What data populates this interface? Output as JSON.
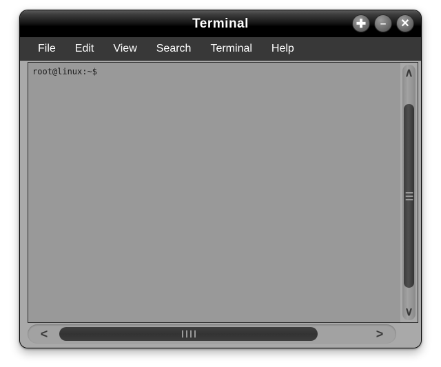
{
  "window": {
    "title": "Terminal",
    "controls": [
      {
        "name": "maximize-button",
        "glyph": "✚",
        "label": "Maximize"
      },
      {
        "name": "minimize-button",
        "glyph": "–",
        "label": "Minimize"
      },
      {
        "name": "close-button",
        "glyph": "✕",
        "label": "Close"
      }
    ]
  },
  "menubar": {
    "items": [
      {
        "label": "File"
      },
      {
        "label": "Edit"
      },
      {
        "label": "View"
      },
      {
        "label": "Search"
      },
      {
        "label": "Terminal"
      },
      {
        "label": "Help"
      }
    ]
  },
  "terminal": {
    "lines": [
      "root@linux:~$"
    ],
    "prompt": "root@linux:~$",
    "background_color": "#999999",
    "text_color": "#1c1c1c"
  },
  "scrollbars": {
    "vertical": {
      "up_arrow": "∧",
      "down_arrow": "∨"
    },
    "horizontal": {
      "left_arrow": "<",
      "right_arrow": ">"
    }
  },
  "theme": {
    "titlebar_color": "#000000",
    "menubar_color": "#383838",
    "frame_color": "#a9a9a9",
    "desktop_color": "#ffffff"
  }
}
